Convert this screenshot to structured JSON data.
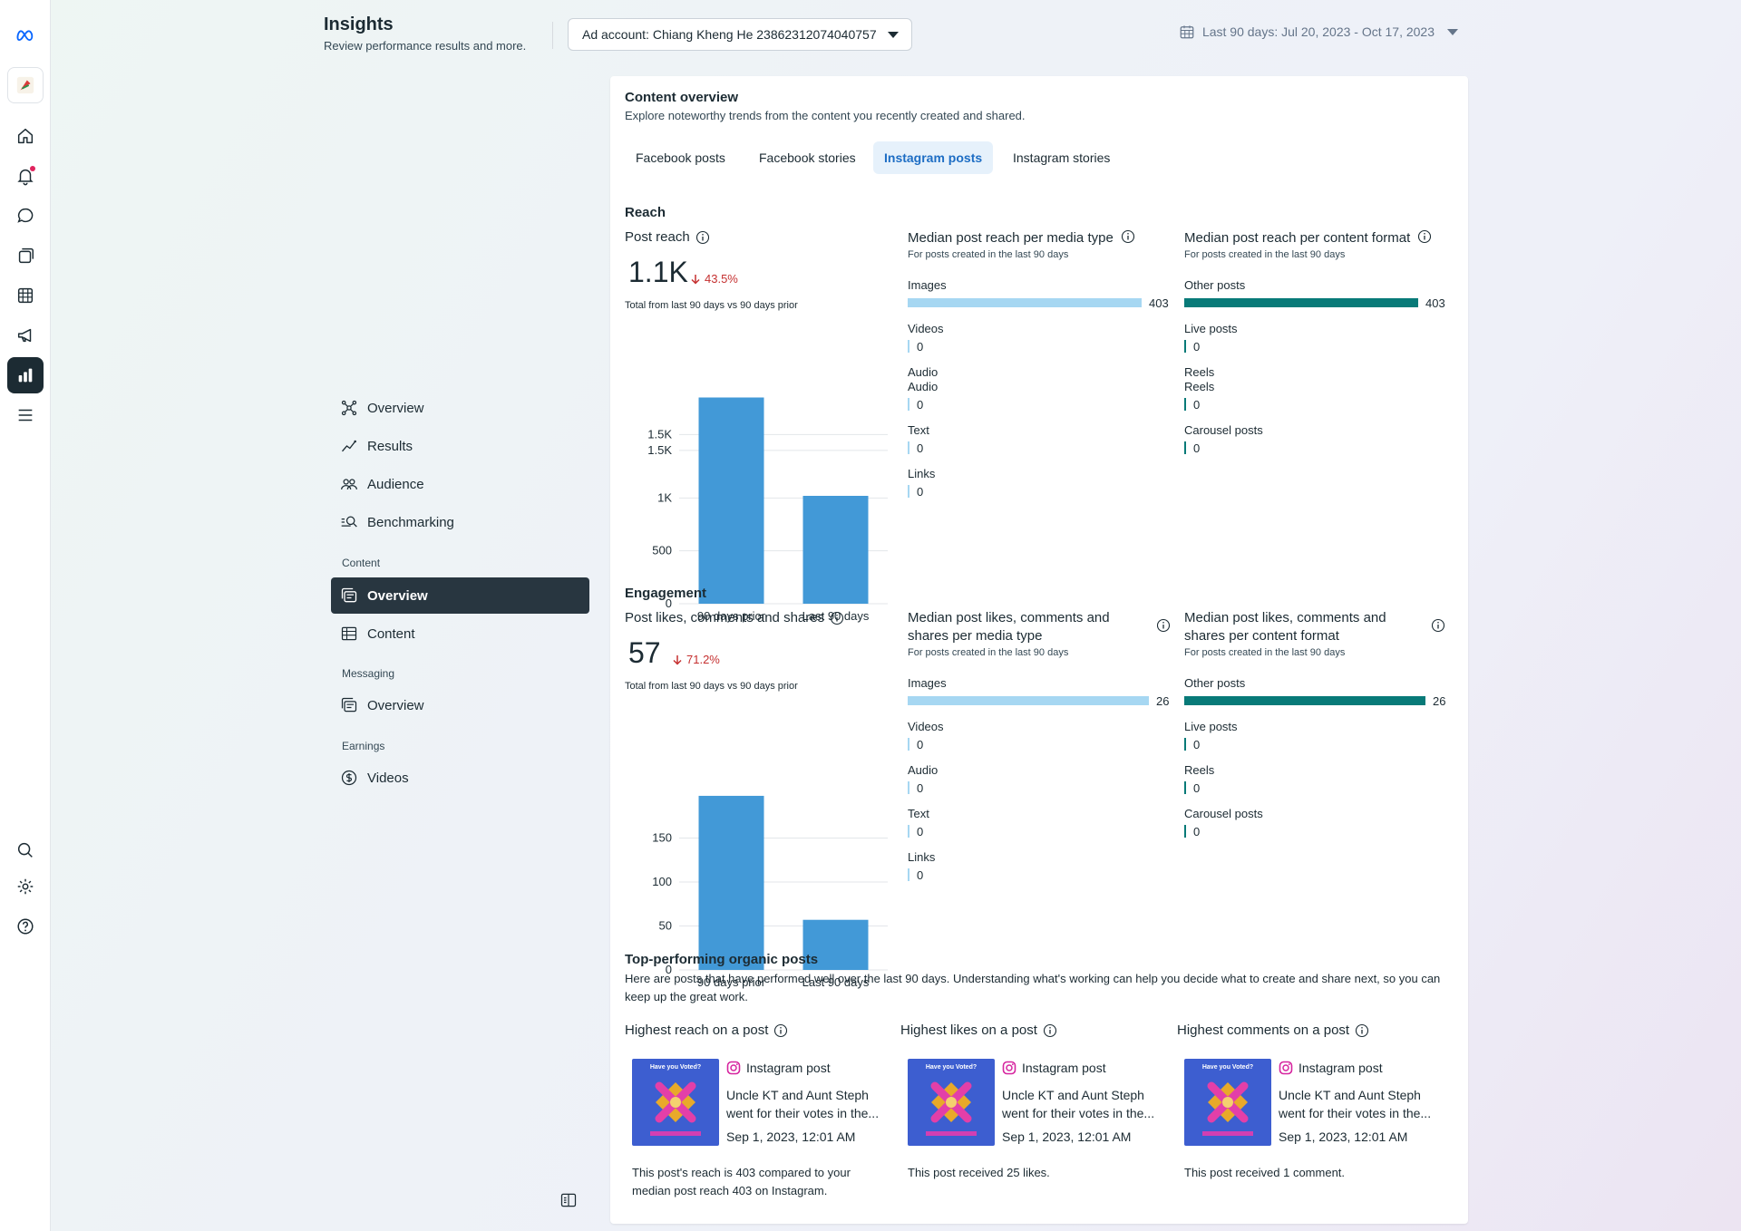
{
  "rail": {
    "items": [
      "meta-logo-icon",
      "avatar",
      "home-icon",
      "bell-icon",
      "chat-icon",
      "pages-icon",
      "table-icon",
      "megaphone-icon",
      "bar-chart-icon",
      "menu-icon",
      "search-icon",
      "gear-icon",
      "help-icon"
    ],
    "active": "bar-chart-icon"
  },
  "header": {
    "title": "Insights",
    "subtitle": "Review performance results and more.",
    "account_label": "Ad account: Chiang Kheng He 23862312074040757",
    "date_range": "Last 90 days: Jul 20, 2023 - Oct 17, 2023"
  },
  "subnav": {
    "main": [
      "Overview",
      "Results",
      "Audience",
      "Benchmarking"
    ],
    "content_heading": "Content",
    "content_items": [
      "Overview",
      "Content"
    ],
    "messaging_heading": "Messaging",
    "messaging_items": [
      "Overview"
    ],
    "earnings_heading": "Earnings",
    "earnings_items": [
      "Videos"
    ]
  },
  "content": {
    "title": "Content overview",
    "subtitle": "Explore noteworthy trends from the content you recently created and shared.",
    "tabs": [
      "Facebook posts",
      "Facebook stories",
      "Instagram posts",
      "Instagram stories"
    ],
    "active_tab": "Instagram posts"
  },
  "reach": {
    "heading": "Reach",
    "metric_label": "Post reach",
    "value": "1.1K",
    "delta": "43.5%",
    "note": "Total from last 90 days vs 90 days prior",
    "media_title": "Median post reach per media type",
    "media_sub": "For posts created in the last 90 days",
    "media_rows": [
      {
        "label": "Images",
        "value": "403"
      },
      {
        "label": "Videos",
        "value": "0"
      },
      {
        "label": "Audio",
        "label2": "Audio",
        "value": "0"
      },
      {
        "label": "Text",
        "value": "0"
      },
      {
        "label": "Links",
        "value": "0"
      }
    ],
    "format_title": "Median post reach per content format",
    "format_sub": "For posts created in the last 90 days",
    "format_rows": [
      {
        "label": "Other posts",
        "value": "403"
      },
      {
        "label": "Live posts",
        "value": "0"
      },
      {
        "label": "Reels",
        "label2": "Reels",
        "value": "0"
      },
      {
        "label": "Carousel posts",
        "value": "0"
      }
    ]
  },
  "engagement": {
    "heading": "Engagement",
    "metric_label": "Post likes, comments and shares",
    "value": "57",
    "delta": "71.2%",
    "note": "Total from last 90 days vs 90 days prior",
    "media_title_1": "Median post likes, comments and",
    "media_title_2": "shares per media type",
    "media_sub": "For posts created in the last 90 days",
    "media_rows": [
      {
        "label": "Images",
        "value": "26"
      },
      {
        "label": "Videos",
        "value": "0"
      },
      {
        "label": "Audio",
        "value": "0"
      },
      {
        "label": "Text",
        "value": "0"
      },
      {
        "label": "Links",
        "value": "0"
      }
    ],
    "format_title_1": "Median post likes, comments and",
    "format_title_2": "shares per content format",
    "format_sub": "For posts created in the last 90 days",
    "format_rows": [
      {
        "label": "Other posts",
        "value": "26"
      },
      {
        "label": "Live posts",
        "value": "0"
      },
      {
        "label": "Reels",
        "value": "0"
      },
      {
        "label": "Carousel posts",
        "value": "0"
      }
    ]
  },
  "chart_data": [
    {
      "type": "bar",
      "categories": [
        "90 days prior",
        "Last 90 days"
      ],
      "values": [
        1950,
        1020
      ],
      "yticks": [
        "0",
        "500",
        "1K",
        "1.5K",
        "1.5K"
      ],
      "ytick_values": [
        0,
        500,
        1000,
        1450,
        1600
      ],
      "ylim": [
        0,
        1800
      ],
      "color": "#4299d7"
    },
    {
      "type": "bar",
      "categories": [
        "90 days prior",
        "Last 90 days"
      ],
      "values": [
        198,
        57
      ],
      "yticks": [
        "0",
        "50",
        "100",
        "150"
      ],
      "ytick_values": [
        0,
        50,
        100,
        150
      ],
      "ylim": [
        0,
        200
      ],
      "color": "#4299d7"
    }
  ],
  "top_posts": {
    "title": "Top-performing organic posts",
    "description": "Here are posts that have performed well over the last 90 days. Understanding what's working can help you decide what to create and share next, so you can keep up the great work.",
    "columns": [
      {
        "heading": "Highest reach on a post",
        "type": "Instagram post",
        "text": "Uncle KT and Aunt Steph went for their votes in the...",
        "date": "Sep 1, 2023, 12:01 AM",
        "summary": "This post's reach is 403 compared to your median post reach 403 on Instagram.",
        "thumb_caption": "Have you Voted?"
      },
      {
        "heading": "Highest likes on a post",
        "type": "Instagram post",
        "text": "Uncle KT and Aunt Steph went for their votes in the...",
        "date": "Sep 1, 2023, 12:01 AM",
        "summary": "This post received 25 likes.",
        "thumb_caption": "Have you Voted?"
      },
      {
        "heading": "Highest comments on a post",
        "type": "Instagram post",
        "text": "Uncle KT and Aunt Steph went for their votes in the...",
        "date": "Sep 1, 2023, 12:01 AM",
        "summary": "This post received 1 comment.",
        "thumb_caption": "Have you Voted?"
      }
    ]
  },
  "colors": {
    "media_bar": "#a6d7f2",
    "format_bar": "#087a78",
    "chart_bar": "#4299d7",
    "delta_down": "#c53030",
    "active_tab_bg": "#e6f1fb"
  }
}
